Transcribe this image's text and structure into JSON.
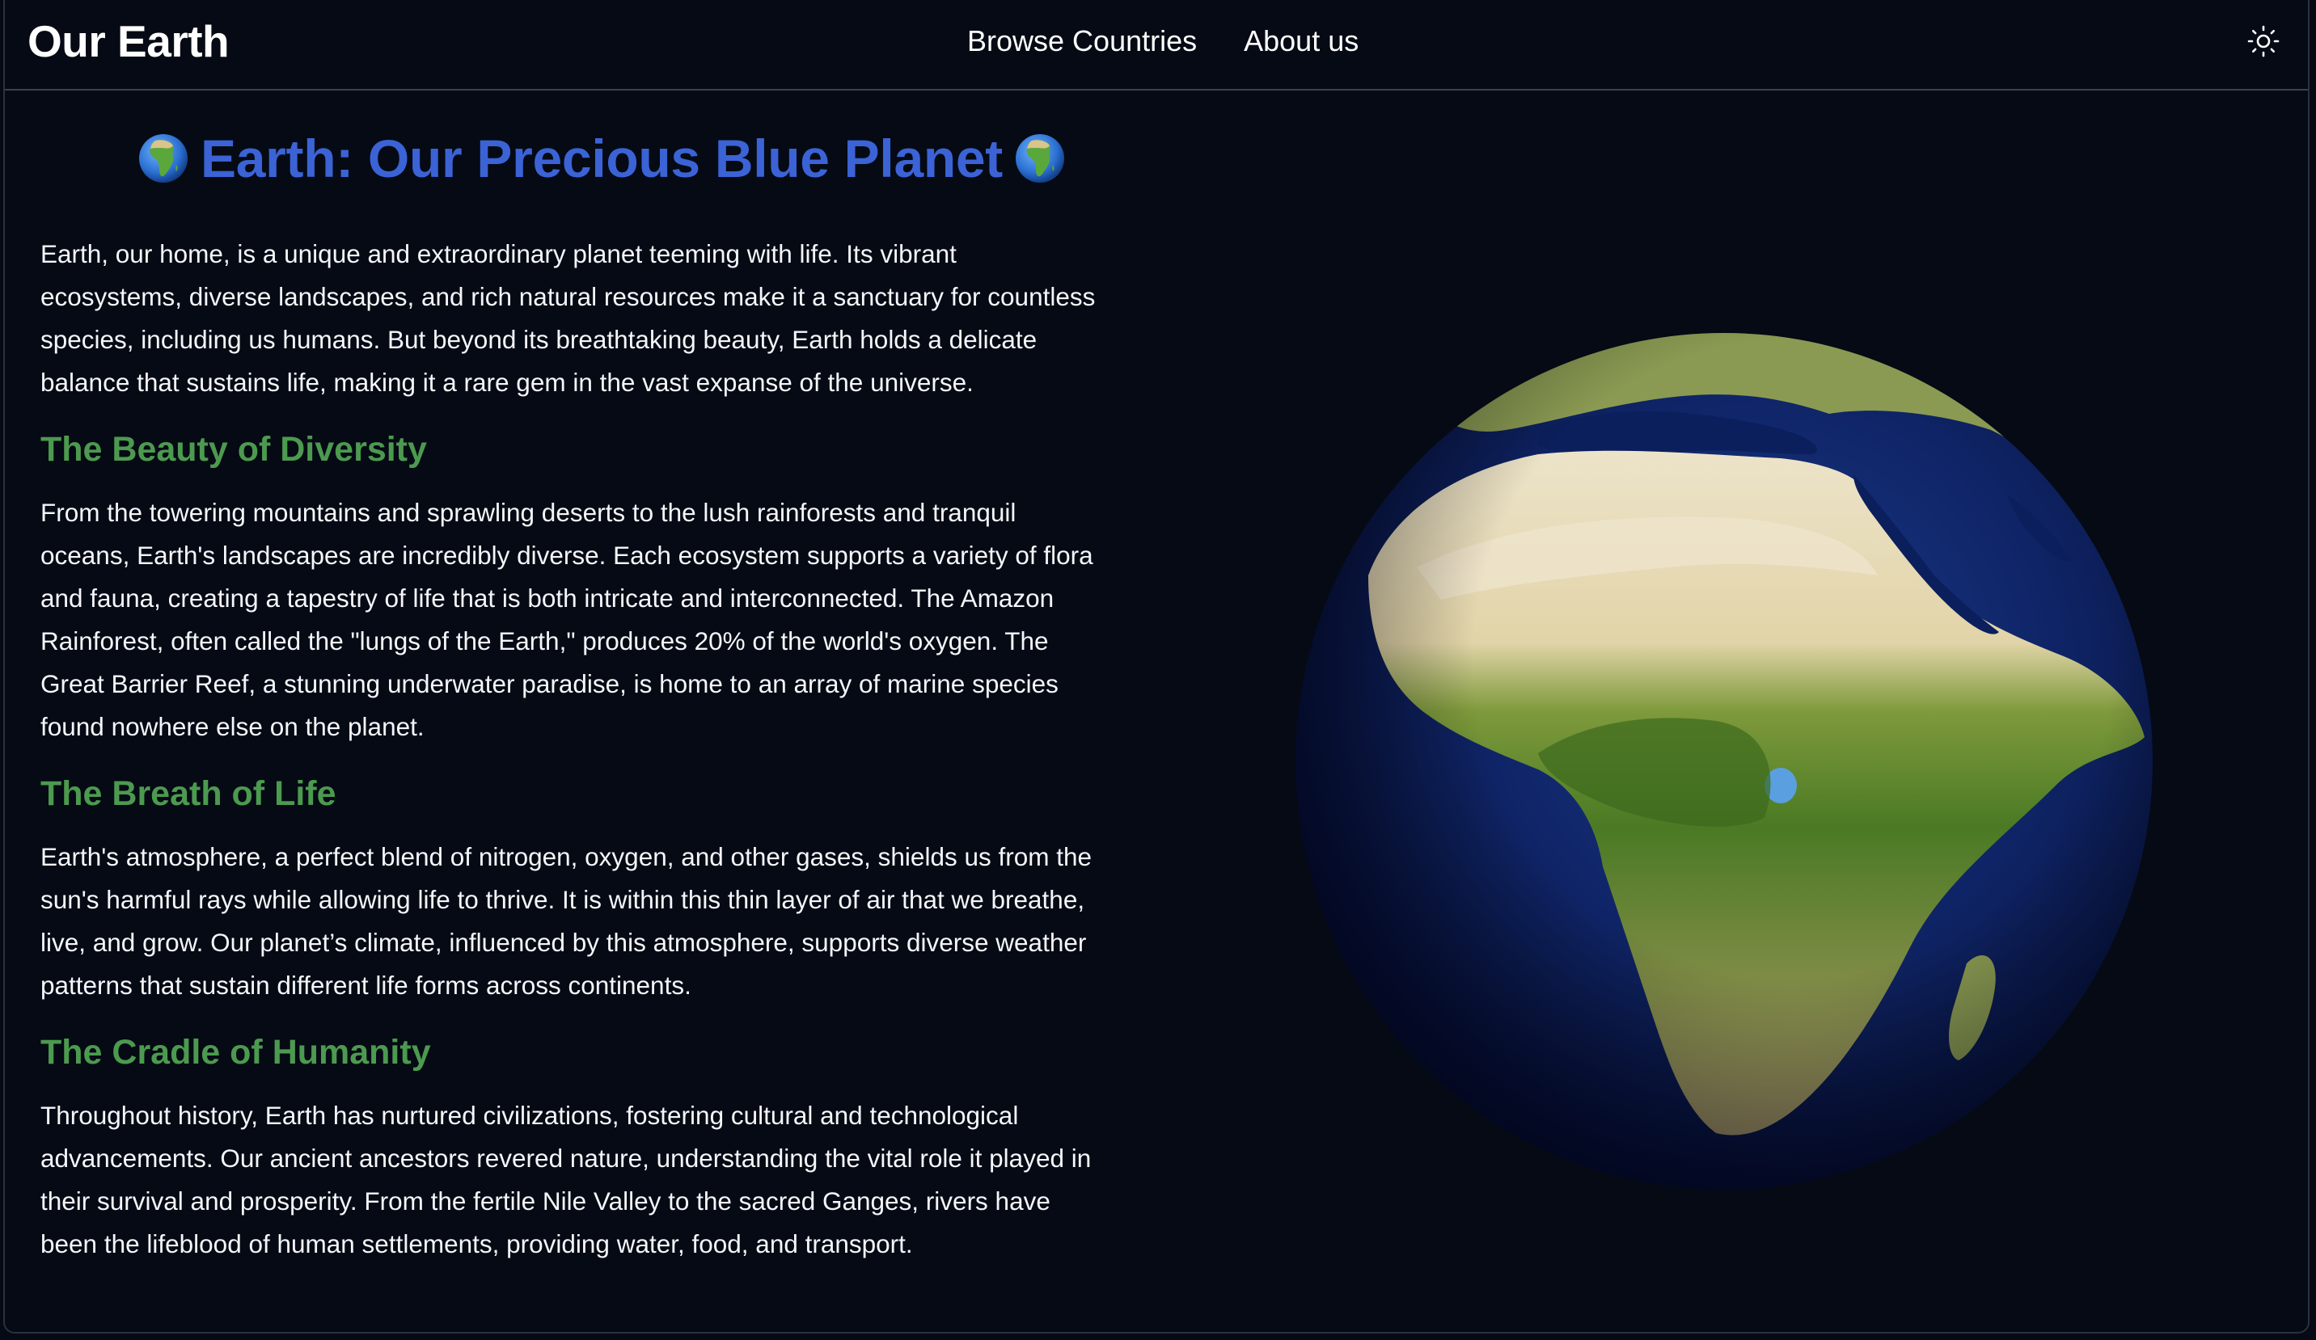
{
  "navbar": {
    "brand": "Our Earth",
    "links": [
      {
        "label": "Browse Countries"
      },
      {
        "label": "About us"
      }
    ],
    "theme_toggle_icon": "sun-icon"
  },
  "hero": {
    "title": "Earth: Our Precious Blue Planet",
    "emoji_icon": "globe-africa-icon"
  },
  "intro": {
    "text": "Earth, our home, is a unique and extraordinary planet teeming with life. Its vibrant ecosystems, diverse landscapes, and rich natural resources make it a sanctuary for countless species, including us humans. But beyond its breathtaking beauty, Earth holds a delicate balance that sustains life, making it a rare gem in the vast expanse of the universe."
  },
  "sections": [
    {
      "heading": "The Beauty of Diversity",
      "text": "From the towering mountains and sprawling deserts to the lush rainforests and tranquil oceans, Earth's landscapes are incredibly diverse. Each ecosystem supports a variety of flora and fauna, creating a tapestry of life that is both intricate and interconnected. The Amazon Rainforest, often called the \"lungs of the Earth,\" produces 20% of the world's oxygen. The Great Barrier Reef, a stunning underwater paradise, is home to an array of marine species found nowhere else on the planet."
    },
    {
      "heading": "The Breath of Life",
      "text": "Earth's atmosphere, a perfect blend of nitrogen, oxygen, and other gases, shields us from the sun's harmful rays while allowing life to thrive. It is within this thin layer of air that we breathe, live, and grow. Our planet’s climate, influenced by this atmosphere, supports diverse weather patterns that sustain different life forms across continents."
    },
    {
      "heading": "The Cradle of Humanity",
      "text": "Throughout history, Earth has nurtured civilizations, fostering cultural and technological advancements. Our ancient ancestors revered nature, understanding the vital role it played in their survival and prosperity. From the fertile Nile Valley to the sacred Ganges, rivers have been the lifeblood of human settlements, providing water, food, and transport."
    }
  ],
  "colors": {
    "background": "#050a14",
    "title_blue": "#3b63d6",
    "heading_green": "#4c9a4f",
    "text": "#f4f6fa"
  }
}
